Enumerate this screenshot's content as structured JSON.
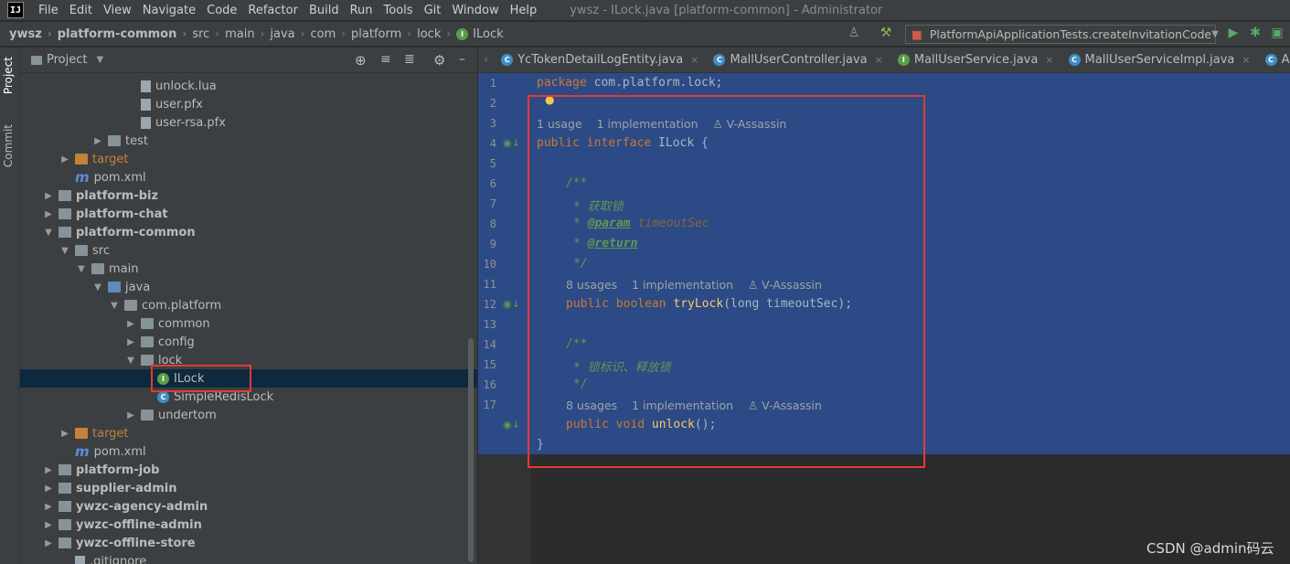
{
  "window": {
    "title": "ywsz - ILock.java [platform-common] - Administrator",
    "logo": "IJ"
  },
  "menu": [
    "File",
    "Edit",
    "View",
    "Navigate",
    "Code",
    "Refactor",
    "Build",
    "Run",
    "Tools",
    "Git",
    "Window",
    "Help"
  ],
  "breadcrumb": [
    "ywsz",
    "platform-common",
    "src",
    "main",
    "java",
    "com",
    "platform",
    "lock",
    "ILock"
  ],
  "run_config": "PlatformApiApplicationTests.createInvitationCode",
  "toolstrip": {
    "project_tab": "Project",
    "commit_tab": "Commit"
  },
  "project_panel": {
    "title": "Project"
  },
  "tree": [
    {
      "label": "unlock.lua",
      "icon": "file",
      "indent": 6
    },
    {
      "label": "user.pfx",
      "icon": "file",
      "indent": 6
    },
    {
      "label": "user-rsa.pfx",
      "icon": "file",
      "indent": 6
    },
    {
      "label": "test",
      "icon": "folder",
      "indent": 4,
      "arrow": "right"
    },
    {
      "label": "target",
      "icon": "folder-orange",
      "indent": 2,
      "arrow": "right"
    },
    {
      "label": "pom.xml",
      "icon": "maven",
      "indent": 2
    },
    {
      "label": "platform-biz",
      "icon": "module",
      "indent": 1,
      "arrow": "right",
      "bold": true
    },
    {
      "label": "platform-chat",
      "icon": "module",
      "indent": 1,
      "arrow": "right",
      "bold": true
    },
    {
      "label": "platform-common",
      "icon": "module",
      "indent": 1,
      "arrow": "down",
      "bold": true
    },
    {
      "label": "src",
      "icon": "folder",
      "indent": 2,
      "arrow": "down"
    },
    {
      "label": "main",
      "icon": "folder",
      "indent": 3,
      "arrow": "down"
    },
    {
      "label": "java",
      "icon": "folder-blue",
      "indent": 4,
      "arrow": "down"
    },
    {
      "label": "com.platform",
      "icon": "folder",
      "indent": 5,
      "arrow": "down"
    },
    {
      "label": "common",
      "icon": "folder",
      "indent": 6,
      "arrow": "right"
    },
    {
      "label": "config",
      "icon": "folder",
      "indent": 6,
      "arrow": "right"
    },
    {
      "label": "lock",
      "icon": "folder",
      "indent": 6,
      "arrow": "down"
    },
    {
      "label": "ILock",
      "icon": "interface",
      "indent": 7,
      "selected": true
    },
    {
      "label": "SimpleRedisLock",
      "icon": "class",
      "indent": 7
    },
    {
      "label": "undertom",
      "icon": "folder",
      "indent": 6,
      "arrow": "right"
    },
    {
      "label": "target",
      "icon": "folder-orange",
      "indent": 2,
      "arrow": "right"
    },
    {
      "label": "pom.xml",
      "icon": "maven",
      "indent": 2
    },
    {
      "label": "platform-job",
      "icon": "module",
      "indent": 1,
      "arrow": "right",
      "bold": true
    },
    {
      "label": "supplier-admin",
      "icon": "module",
      "indent": 1,
      "arrow": "right",
      "bold": true
    },
    {
      "label": "ywzc-agency-admin",
      "icon": "module",
      "indent": 1,
      "arrow": "right",
      "bold": true
    },
    {
      "label": "ywzc-offline-admin",
      "icon": "module",
      "indent": 1,
      "arrow": "right",
      "bold": true
    },
    {
      "label": "ywzc-offline-store",
      "icon": "module",
      "indent": 1,
      "arrow": "right",
      "bold": true
    },
    {
      "label": ".gitignore",
      "icon": "file",
      "indent": 2
    }
  ],
  "tabs": [
    {
      "label": "YcTokenDetailLogEntity.java",
      "icon": "class"
    },
    {
      "label": "MallUserController.java",
      "icon": "class"
    },
    {
      "label": "MallUserService.java",
      "icon": "interface"
    },
    {
      "label": "MallUserServiceImpl.java",
      "icon": "class"
    },
    {
      "label": "AppPublicBen",
      "icon": "class"
    }
  ],
  "editor": {
    "line_numbers": [
      "1",
      "2",
      "3",
      "4",
      "5",
      "6",
      "7",
      "8",
      "9",
      "10",
      "11",
      "12",
      "13",
      "14",
      "15",
      "16",
      "17"
    ],
    "line1": {
      "kw": "package",
      "rest": " com.platform.lock;"
    },
    "hint1": {
      "usages": "1 usage",
      "impl": "1 implementation",
      "author": "V-Assassin"
    },
    "line3": {
      "kw": "public interface",
      "rest": " ILock {"
    },
    "doc1": {
      "open": "/**",
      "desc": "* 获取锁",
      "param_tag": "@param",
      "param_name": "timeoutSec",
      "return_tag": "@return",
      "close": "*/"
    },
    "hint2": {
      "usages": "8 usages",
      "impl": "1 implementation",
      "author": "V-Assassin"
    },
    "line10": {
      "kw": "public boolean",
      "fn": "tryLock",
      "args": "(long timeoutSec);"
    },
    "doc2": {
      "open": "/**",
      "desc": "* 锁标识、释放锁",
      "close": "*/"
    },
    "hint3": {
      "usages": "8 usages",
      "impl": "1 implementation",
      "author": "V-Assassin"
    },
    "line15": {
      "kw": "public void",
      "fn": "unlock",
      "args": "();"
    },
    "line16": "}"
  },
  "watermark": "CSDN @admin码云",
  "colors": {
    "highlight": "#e53935",
    "selection": "#2c4a85",
    "keyword": "#cc7832",
    "javadoc": "#629755",
    "method": "#ffc66d"
  }
}
